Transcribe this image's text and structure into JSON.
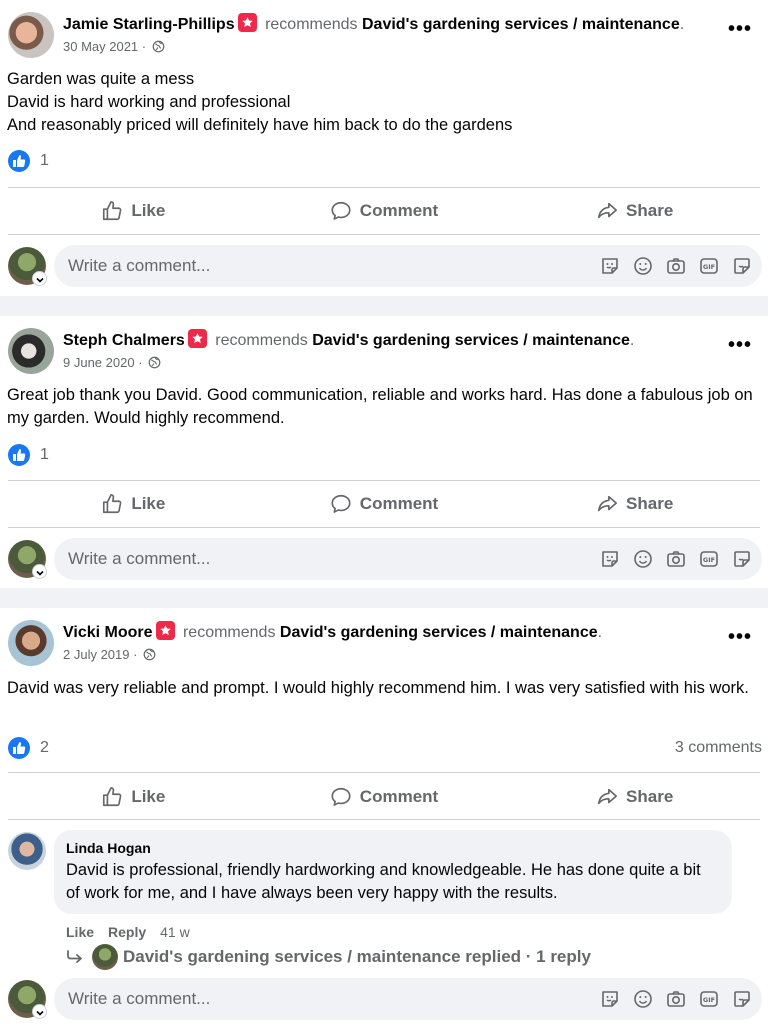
{
  "posts": [
    {
      "author": "Jamie Starling-Phillips",
      "verb": "recommends",
      "page": "David's gardening services / maintenance",
      "punct": ".",
      "date": "30 May 2021",
      "sep": " · ",
      "body": [
        "Garden was quite a mess",
        "David is hard working and professional",
        "And reasonably priced will definitely have him back to do the gardens"
      ],
      "reaction_count": "1",
      "comment_count": ""
    },
    {
      "author": "Steph Chalmers",
      "verb": "recommends",
      "page": "David's gardening services / maintenance",
      "punct": ".",
      "date": "9 June 2020",
      "sep": " · ",
      "body": [
        "Great job thank you David. Good communication, reliable and works hard. Has done a fabulous job on my garden. Would highly recommend."
      ],
      "reaction_count": "1",
      "comment_count": ""
    },
    {
      "author": "Vicki Moore",
      "verb": "recommends",
      "page": "David's gardening services / maintenance",
      "punct": ".",
      "date": "2 July 2019",
      "sep": " · ",
      "body": [
        "David was very reliable and prompt. I would highly recommend him. I was very satisfied with his work."
      ],
      "reaction_count": "2",
      "comment_count": "3 comments",
      "comment": {
        "author": "Linda Hogan",
        "text": "David is professional, friendly hardworking and knowledgeable. He has done quite a bit of work for me, and I have always been very happy with the results.",
        "like_label": "Like",
        "reply_label": "Reply",
        "age": "41 w",
        "replied_text": "David's gardening services / maintenance replied · 1 reply"
      }
    }
  ],
  "actions": {
    "like": "Like",
    "comment": "Comment",
    "share": "Share"
  },
  "composer": {
    "placeholder": "Write a comment..."
  },
  "more_label": "•••",
  "colors": {
    "accent": "#1877f2",
    "badge": "#f02849",
    "muted": "#65676b",
    "divider": "#ced0d4"
  }
}
